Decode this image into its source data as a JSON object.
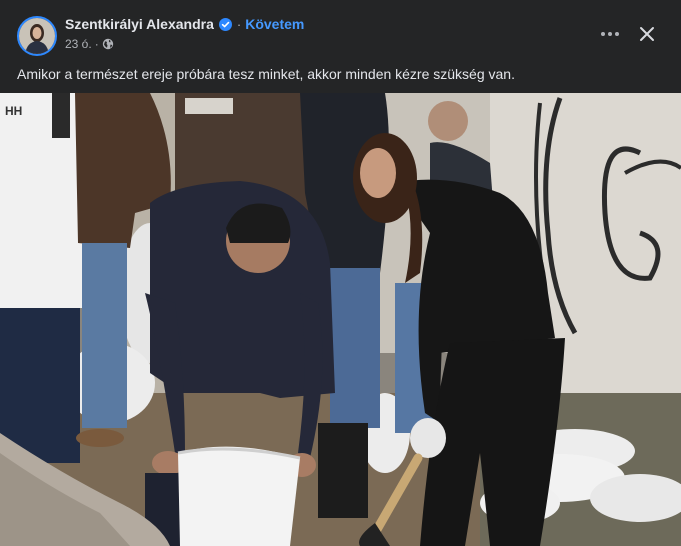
{
  "post": {
    "author_name": "Szentkirályi Alexandra",
    "follow_label": "Követem",
    "separator": "·",
    "timestamp": "23 ó.",
    "audience_icon": "globe-icon",
    "caption": "Amikor a természet ereje próbára tesz minket, akkor minden kézre szükség van.",
    "photo_jacket_text": "HH"
  },
  "colors": {
    "background": "#242526",
    "link": "#4599ff",
    "verified": "#2d88ff",
    "text_primary": "#e4e6eb",
    "text_secondary": "#b0b3b8"
  },
  "icons": {
    "more": "more-horizontal-icon",
    "close": "close-icon",
    "verified": "verified-badge-icon"
  }
}
